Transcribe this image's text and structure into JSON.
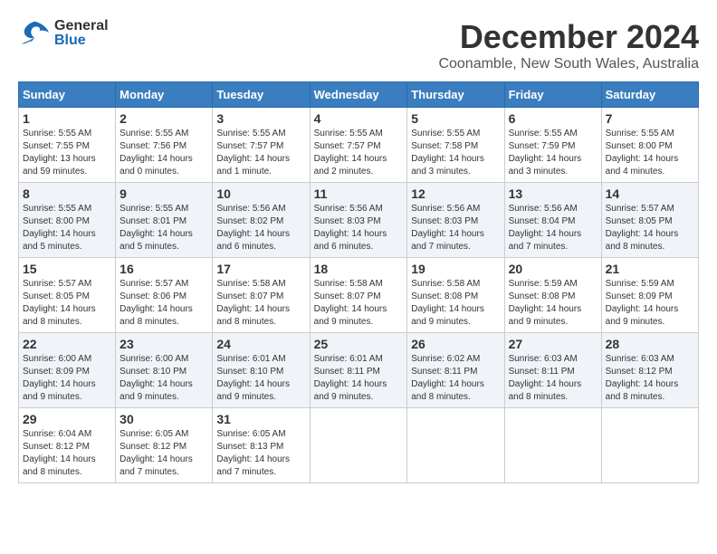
{
  "header": {
    "logo_line1": "General",
    "logo_line2": "Blue",
    "month": "December 2024",
    "location": "Coonamble, New South Wales, Australia"
  },
  "weekdays": [
    "Sunday",
    "Monday",
    "Tuesday",
    "Wednesday",
    "Thursday",
    "Friday",
    "Saturday"
  ],
  "weeks": [
    [
      {
        "day": "1",
        "sunrise": "5:55 AM",
        "sunset": "7:55 PM",
        "daylight": "13 hours and 59 minutes."
      },
      {
        "day": "2",
        "sunrise": "5:55 AM",
        "sunset": "7:56 PM",
        "daylight": "14 hours and 0 minutes."
      },
      {
        "day": "3",
        "sunrise": "5:55 AM",
        "sunset": "7:57 PM",
        "daylight": "14 hours and 1 minute."
      },
      {
        "day": "4",
        "sunrise": "5:55 AM",
        "sunset": "7:57 PM",
        "daylight": "14 hours and 2 minutes."
      },
      {
        "day": "5",
        "sunrise": "5:55 AM",
        "sunset": "7:58 PM",
        "daylight": "14 hours and 3 minutes."
      },
      {
        "day": "6",
        "sunrise": "5:55 AM",
        "sunset": "7:59 PM",
        "daylight": "14 hours and 3 minutes."
      },
      {
        "day": "7",
        "sunrise": "5:55 AM",
        "sunset": "8:00 PM",
        "daylight": "14 hours and 4 minutes."
      }
    ],
    [
      {
        "day": "8",
        "sunrise": "5:55 AM",
        "sunset": "8:00 PM",
        "daylight": "14 hours and 5 minutes."
      },
      {
        "day": "9",
        "sunrise": "5:55 AM",
        "sunset": "8:01 PM",
        "daylight": "14 hours and 5 minutes."
      },
      {
        "day": "10",
        "sunrise": "5:56 AM",
        "sunset": "8:02 PM",
        "daylight": "14 hours and 6 minutes."
      },
      {
        "day": "11",
        "sunrise": "5:56 AM",
        "sunset": "8:03 PM",
        "daylight": "14 hours and 6 minutes."
      },
      {
        "day": "12",
        "sunrise": "5:56 AM",
        "sunset": "8:03 PM",
        "daylight": "14 hours and 7 minutes."
      },
      {
        "day": "13",
        "sunrise": "5:56 AM",
        "sunset": "8:04 PM",
        "daylight": "14 hours and 7 minutes."
      },
      {
        "day": "14",
        "sunrise": "5:57 AM",
        "sunset": "8:05 PM",
        "daylight": "14 hours and 8 minutes."
      }
    ],
    [
      {
        "day": "15",
        "sunrise": "5:57 AM",
        "sunset": "8:05 PM",
        "daylight": "14 hours and 8 minutes."
      },
      {
        "day": "16",
        "sunrise": "5:57 AM",
        "sunset": "8:06 PM",
        "daylight": "14 hours and 8 minutes."
      },
      {
        "day": "17",
        "sunrise": "5:58 AM",
        "sunset": "8:07 PM",
        "daylight": "14 hours and 8 minutes."
      },
      {
        "day": "18",
        "sunrise": "5:58 AM",
        "sunset": "8:07 PM",
        "daylight": "14 hours and 9 minutes."
      },
      {
        "day": "19",
        "sunrise": "5:58 AM",
        "sunset": "8:08 PM",
        "daylight": "14 hours and 9 minutes."
      },
      {
        "day": "20",
        "sunrise": "5:59 AM",
        "sunset": "8:08 PM",
        "daylight": "14 hours and 9 minutes."
      },
      {
        "day": "21",
        "sunrise": "5:59 AM",
        "sunset": "8:09 PM",
        "daylight": "14 hours and 9 minutes."
      }
    ],
    [
      {
        "day": "22",
        "sunrise": "6:00 AM",
        "sunset": "8:09 PM",
        "daylight": "14 hours and 9 minutes."
      },
      {
        "day": "23",
        "sunrise": "6:00 AM",
        "sunset": "8:10 PM",
        "daylight": "14 hours and 9 minutes."
      },
      {
        "day": "24",
        "sunrise": "6:01 AM",
        "sunset": "8:10 PM",
        "daylight": "14 hours and 9 minutes."
      },
      {
        "day": "25",
        "sunrise": "6:01 AM",
        "sunset": "8:11 PM",
        "daylight": "14 hours and 9 minutes."
      },
      {
        "day": "26",
        "sunrise": "6:02 AM",
        "sunset": "8:11 PM",
        "daylight": "14 hours and 8 minutes."
      },
      {
        "day": "27",
        "sunrise": "6:03 AM",
        "sunset": "8:11 PM",
        "daylight": "14 hours and 8 minutes."
      },
      {
        "day": "28",
        "sunrise": "6:03 AM",
        "sunset": "8:12 PM",
        "daylight": "14 hours and 8 minutes."
      }
    ],
    [
      {
        "day": "29",
        "sunrise": "6:04 AM",
        "sunset": "8:12 PM",
        "daylight": "14 hours and 8 minutes."
      },
      {
        "day": "30",
        "sunrise": "6:05 AM",
        "sunset": "8:12 PM",
        "daylight": "14 hours and 7 minutes."
      },
      {
        "day": "31",
        "sunrise": "6:05 AM",
        "sunset": "8:13 PM",
        "daylight": "14 hours and 7 minutes."
      },
      null,
      null,
      null,
      null
    ]
  ]
}
